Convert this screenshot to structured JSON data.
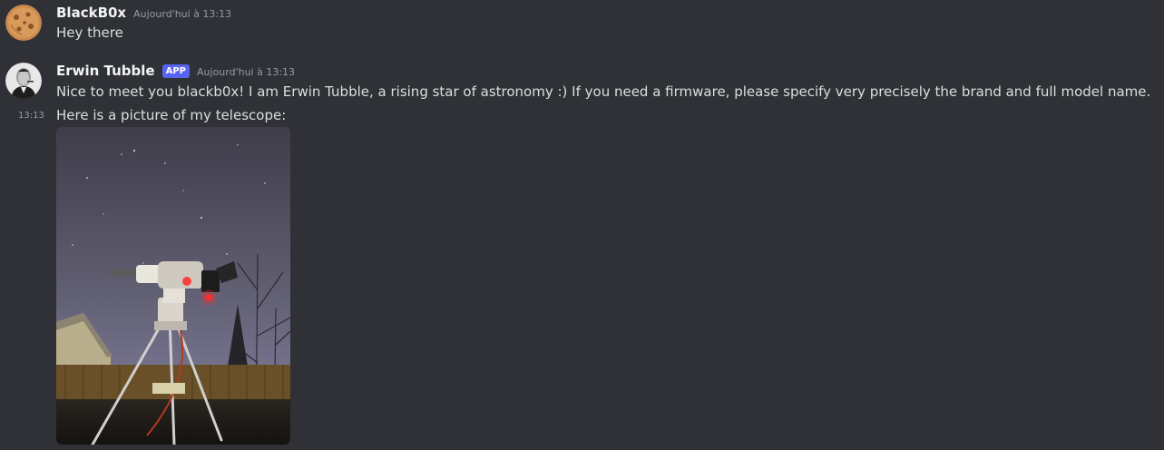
{
  "messages": [
    {
      "username": "BlackB0x",
      "timestamp": "Aujourd'hui à 13:13",
      "text": "Hey there"
    },
    {
      "username": "Erwin Tubble",
      "badge": "APP",
      "timestamp": "Aujourd'hui à 13:13",
      "text": "Nice to meet you blackb0x! I am Erwin Tubble, a rising star of astronomy :) If you need a firmware, please specify very precisely the brand and full model name."
    },
    {
      "side_timestamp": "13:13",
      "text": "Here is a picture of my telescope:"
    }
  ],
  "colors": {
    "background": "#2f3136",
    "username": "#f2f3f5",
    "text": "#dbdee1",
    "muted": "#949ba4",
    "badge": "#5865f2"
  },
  "icons": {
    "avatar_1": "cookie-avatar",
    "avatar_2": "portrait-avatar",
    "attachment": "telescope-photo"
  }
}
